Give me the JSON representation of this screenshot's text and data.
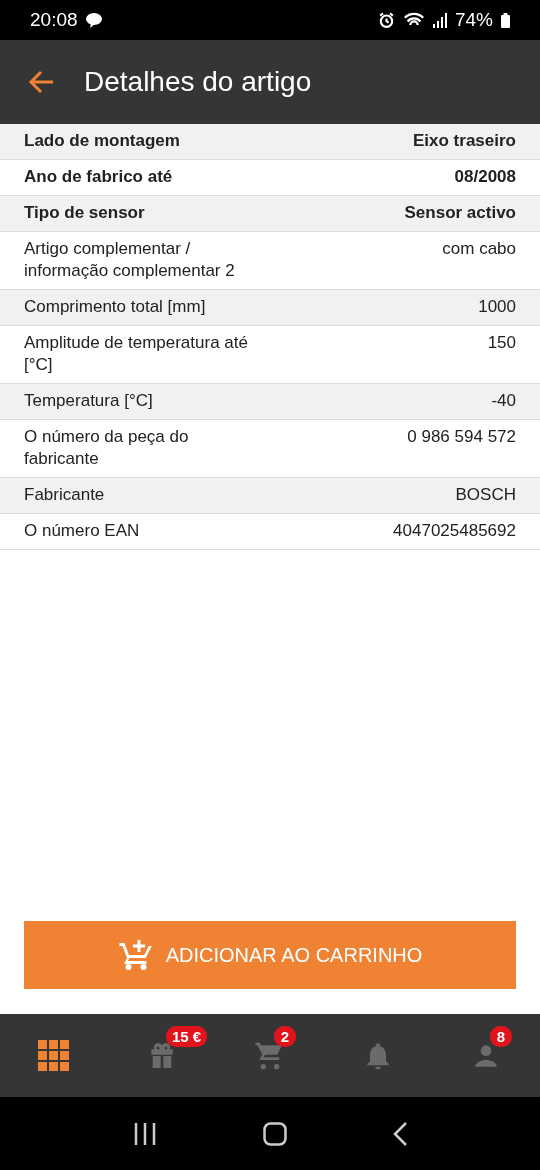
{
  "status_bar": {
    "time": "20:08",
    "battery": "74%"
  },
  "app_bar": {
    "title": "Detalhes do artigo"
  },
  "details": [
    {
      "label": "Lado de montagem",
      "value": "Eixo traseiro",
      "bold": true
    },
    {
      "label": "Ano de fabrico até",
      "value": "08/2008",
      "bold": true
    },
    {
      "label": "Tipo de sensor",
      "value": "Sensor activo",
      "bold": true
    },
    {
      "label": "Artigo complementar / informação complementar 2",
      "value": "com cabo",
      "bold": false
    },
    {
      "label": "Comprimento total [mm]",
      "value": "1000",
      "bold": false
    },
    {
      "label": "Amplitude de temperatura até [°C]",
      "value": "150",
      "bold": false
    },
    {
      "label": "Temperatura [°C]",
      "value": "-40",
      "bold": false
    },
    {
      "label": "O número da peça do fabricante",
      "value": "0 986 594 572",
      "bold": false
    },
    {
      "label": "Fabricante",
      "value": "BOSCH",
      "bold": false
    },
    {
      "label": "O número EAN",
      "value": "4047025485692",
      "bold": false
    }
  ],
  "add_button": {
    "label": "ADICIONAR AO CARRINHO"
  },
  "bottom_nav": [
    {
      "kind": "grid",
      "selected": true
    },
    {
      "kind": "gift",
      "selected": false,
      "badge": "15 €"
    },
    {
      "kind": "cart",
      "selected": false,
      "badge": "2"
    },
    {
      "kind": "bell",
      "selected": false
    },
    {
      "kind": "person",
      "selected": false,
      "badge": "8"
    }
  ]
}
